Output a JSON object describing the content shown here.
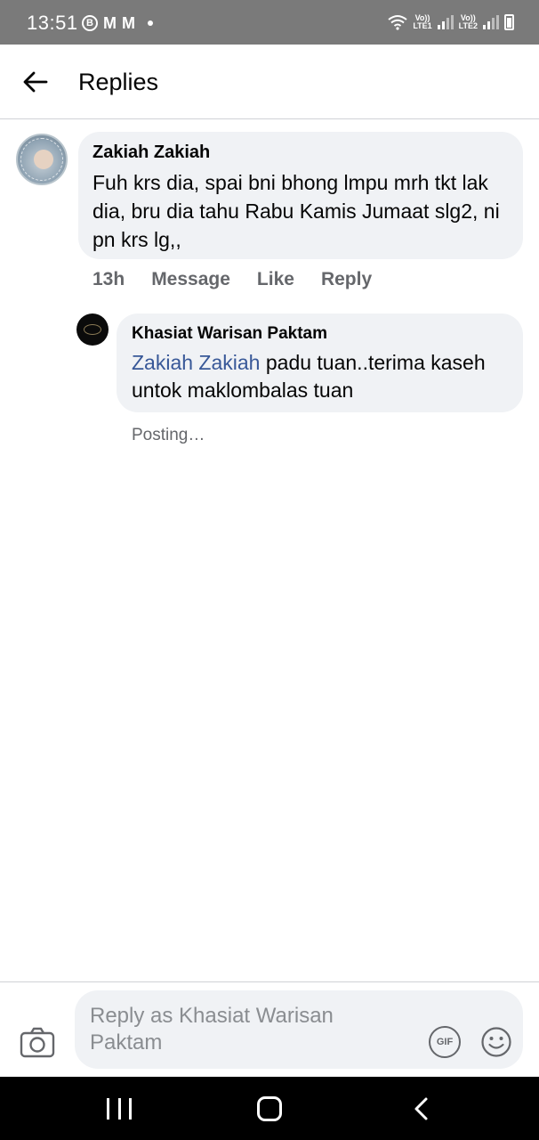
{
  "status_bar": {
    "time": "13:51",
    "left_icons": [
      "b-circle-icon",
      "m-icon",
      "m-icon",
      "dot-icon"
    ],
    "sim1_label_top": "Vo))",
    "sim1_label_bottom": "LTE1",
    "sim2_label_top": "Vo))",
    "sim2_label_bottom": "LTE2",
    "wifi_badge": "6"
  },
  "header": {
    "title": "Replies",
    "back_icon": "arrow-left-icon"
  },
  "comment": {
    "author": "Zakiah Zakiah",
    "text": "Fuh krs dia, spai bni bhong lmpu mrh tkt lak dia, bru dia tahu Rabu Kamis Jumaat slg2, ni pn krs lg,,",
    "time": "13h",
    "actions": [
      "Message",
      "Like",
      "Reply"
    ]
  },
  "reply": {
    "author": "Khasiat Warisan Paktam",
    "mention": "Zakiah Zakiah",
    "text": " padu tuan..terima kaseh untok maklombalas tuan",
    "status": "Posting…"
  },
  "composer": {
    "placeholder": "Reply as Khasiat Warisan Paktam",
    "gif_label": "GIF",
    "camera_icon": "camera-icon",
    "emoji_icon": "emoji-icon"
  },
  "colors": {
    "status_bar_bg": "#7a7a7a",
    "bubble_bg": "#f0f2f5",
    "mention": "#385898",
    "secondary_text": "#65676b",
    "navbar_bg": "#000000"
  }
}
